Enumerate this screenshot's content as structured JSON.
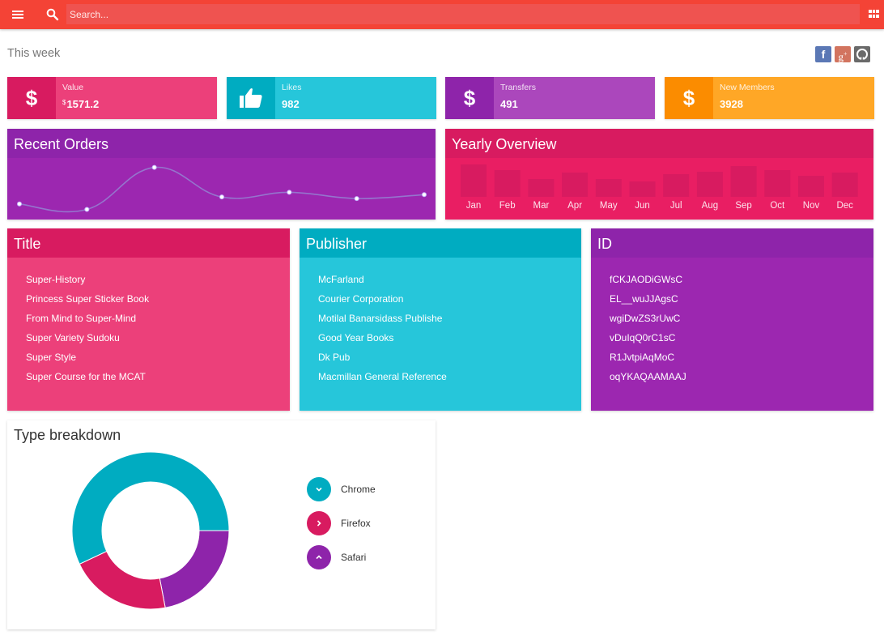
{
  "topbar": {
    "menu_icon": "menu-icon",
    "search_icon": "search-icon",
    "search_placeholder": "Search...",
    "search_value": "",
    "apps_icon": "apps-grid-icon",
    "color": "#f44336"
  },
  "header": {
    "title": "This week",
    "social": [
      {
        "name": "facebook",
        "glyph": "f",
        "color": "#5b78b5"
      },
      {
        "name": "google-plus",
        "glyph": "g+",
        "color": "#d2745f"
      },
      {
        "name": "github",
        "glyph": "github",
        "color": "#6a6a6a"
      }
    ]
  },
  "stats": [
    {
      "label": "Value",
      "currency": "$",
      "value": "1571.2",
      "icon": "dollar-icon",
      "icon_bg": "#d81b60",
      "bg": "#ec407a"
    },
    {
      "label": "Likes",
      "currency": "",
      "value": "982",
      "icon": "thumbs-up-icon",
      "icon_bg": "#00acc1",
      "bg": "#26c6da"
    },
    {
      "label": "Transfers",
      "currency": "",
      "value": "491",
      "icon": "dollar-icon",
      "icon_bg": "#8e24aa",
      "bg": "#ab47bc"
    },
    {
      "label": "New Members",
      "currency": "",
      "value": "3928",
      "icon": "dollar-icon",
      "icon_bg": "#fb8c00",
      "bg": "#ffa726"
    }
  ],
  "recent_orders": {
    "title": "Recent Orders",
    "head_bg": "#8e24aa",
    "bg": "#9c27b0"
  },
  "yearly_overview": {
    "title": "Yearly Overview",
    "head_bg": "#d81b60",
    "bg": "#e91e63"
  },
  "tables": [
    {
      "title": "Title",
      "head_bg": "#d81b60",
      "bg": "#ec407a",
      "items": [
        "Super-History",
        "Princess Super Sticker Book",
        "From Mind to Super-Mind",
        "Super Variety Sudoku",
        "Super Style",
        "Super Course for the MCAT"
      ]
    },
    {
      "title": "Publisher",
      "head_bg": "#00acc1",
      "bg": "#26c6da",
      "items": [
        "McFarland",
        "Courier Corporation",
        "Motilal Banarsidass Publishe",
        "Good Year Books",
        "Dk Pub",
        "Macmillan General Reference"
      ]
    },
    {
      "title": "ID",
      "head_bg": "#8e24aa",
      "bg": "#9c27b0",
      "items": [
        "fCKJAODiGWsC",
        "EL__wuJJAgsC",
        "wgiDwZS3rUwC",
        "vDuIqQ0rC1sC",
        "R1JvtpiAqMoC",
        "oqYKAQAAMAAJ"
      ]
    }
  ],
  "type_breakdown": {
    "title": "Type breakdown",
    "legend": [
      {
        "label": "Chrome",
        "icon": "chevron-down-icon",
        "color": "#00acc1"
      },
      {
        "label": "Firefox",
        "icon": "chevron-right-icon",
        "color": "#d81b60"
      },
      {
        "label": "Safari",
        "icon": "chevron-up-icon",
        "color": "#8e24aa"
      }
    ]
  },
  "chart_data": [
    {
      "type": "line",
      "title": "Recent Orders",
      "x": [
        1,
        2,
        3,
        4,
        5,
        6,
        7
      ],
      "values": [
        20,
        13,
        67,
        29,
        35,
        27,
        32
      ],
      "ylim": [
        0,
        75
      ],
      "smooth": true,
      "grid": false,
      "line_color": "#9575cd",
      "point_color": "#ffffff"
    },
    {
      "type": "bar",
      "title": "Yearly Overview",
      "categories": [
        "Jan",
        "Feb",
        "Mar",
        "Apr",
        "May",
        "Jun",
        "Jul",
        "Aug",
        "Sep",
        "Oct",
        "Nov",
        "Dec"
      ],
      "values": [
        40,
        33,
        22,
        30,
        22,
        19,
        28,
        31,
        38,
        33,
        26,
        30
      ],
      "ylim": [
        0,
        45
      ],
      "grid": false,
      "bar_color": "#d81b60"
    },
    {
      "type": "pie",
      "title": "Type breakdown",
      "donut": true,
      "categories": [
        "Safari",
        "Firefox",
        "Chrome"
      ],
      "values": [
        22,
        21,
        57
      ],
      "colors": [
        "#8e24aa",
        "#d81b60",
        "#00acc1"
      ],
      "legend": "right"
    }
  ]
}
